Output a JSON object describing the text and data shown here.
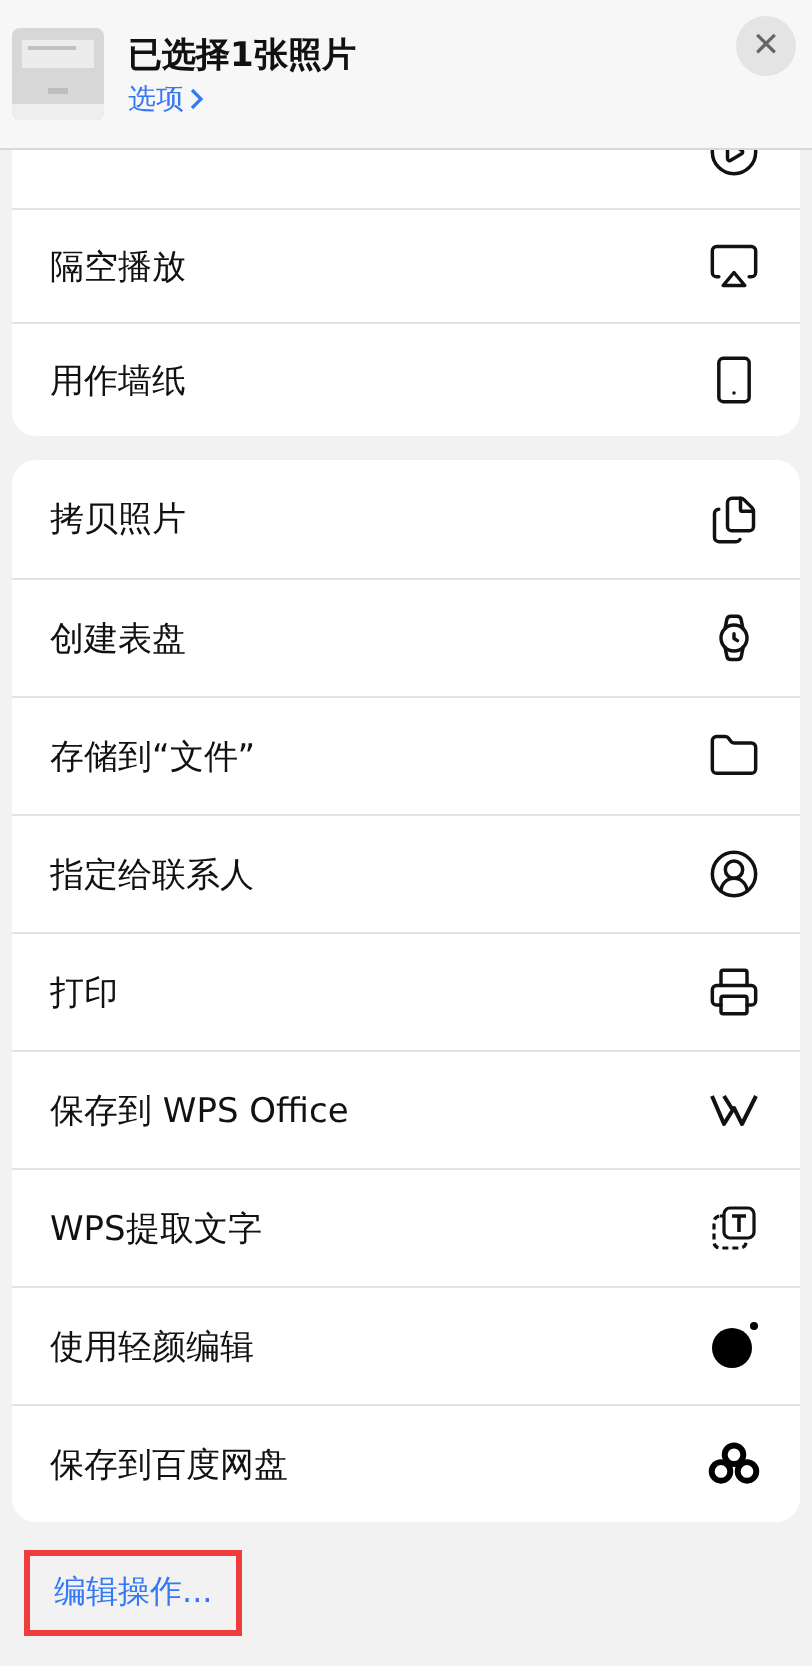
{
  "header": {
    "title": "已选择1张照片",
    "options_link": "选项",
    "close_label": "✕"
  },
  "sections": [
    {
      "clipped_row_above": true,
      "items": [
        {
          "label": "隔空播放"
        },
        {
          "label": "用作墙纸"
        }
      ]
    },
    {
      "items": [
        {
          "label": "拷贝照片"
        },
        {
          "label": "创建表盘"
        },
        {
          "label": "存储到“文件”"
        },
        {
          "label": "指定给联系人"
        },
        {
          "label": "打印"
        },
        {
          "label": "保存到 WPS Office"
        },
        {
          "label": "WPS提取文字"
        },
        {
          "label": "使用轻颜编辑"
        },
        {
          "label": "保存到百度网盘"
        }
      ]
    }
  ],
  "footer_action": {
    "label": "编辑操作...",
    "highlighted": true
  }
}
